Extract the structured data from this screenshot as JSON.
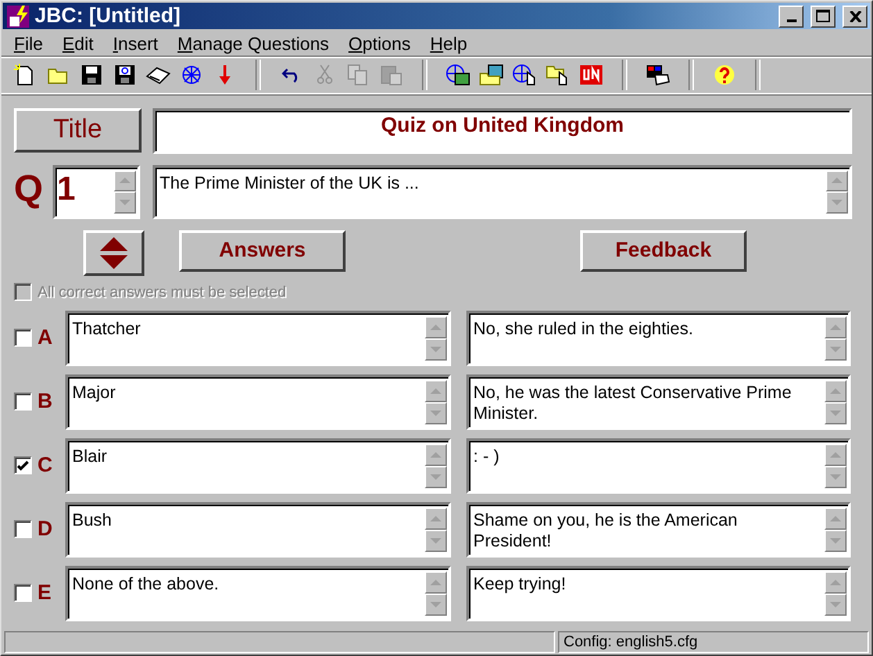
{
  "window": {
    "title": "JBC: [Untitled]"
  },
  "menu": [
    {
      "label": "File"
    },
    {
      "label": "Edit"
    },
    {
      "label": "Insert"
    },
    {
      "label": "Manage Questions"
    },
    {
      "label": "Options"
    },
    {
      "label": "Help"
    }
  ],
  "title_button": "Title",
  "quiz_title": "Quiz on United Kingdom",
  "question": {
    "label": "Q",
    "number": "1",
    "text": "The Prime Minister of the UK is ..."
  },
  "column_buttons": [
    "Answers",
    "Feedback"
  ],
  "all_correct": {
    "label": "All correct answers must be selected",
    "checked": false,
    "disabled": true
  },
  "answers": [
    {
      "letter": "A",
      "text": "Thatcher",
      "feedback": "No, she ruled in the eighties.",
      "correct": false
    },
    {
      "letter": "B",
      "text": "Major",
      "feedback": "No, he was the latest Conservative Prime Minister.",
      "correct": false
    },
    {
      "letter": "C",
      "text": "Blair",
      "feedback": ": - )",
      "correct": true
    },
    {
      "letter": "D",
      "text": "Bush",
      "feedback": "Shame on you, he is the American President!",
      "correct": false
    },
    {
      "letter": "E",
      "text": "None of the above.",
      "feedback": "Keep trying!",
      "correct": false
    }
  ],
  "status_bar": {
    "config": "Config: english5.cfg"
  }
}
